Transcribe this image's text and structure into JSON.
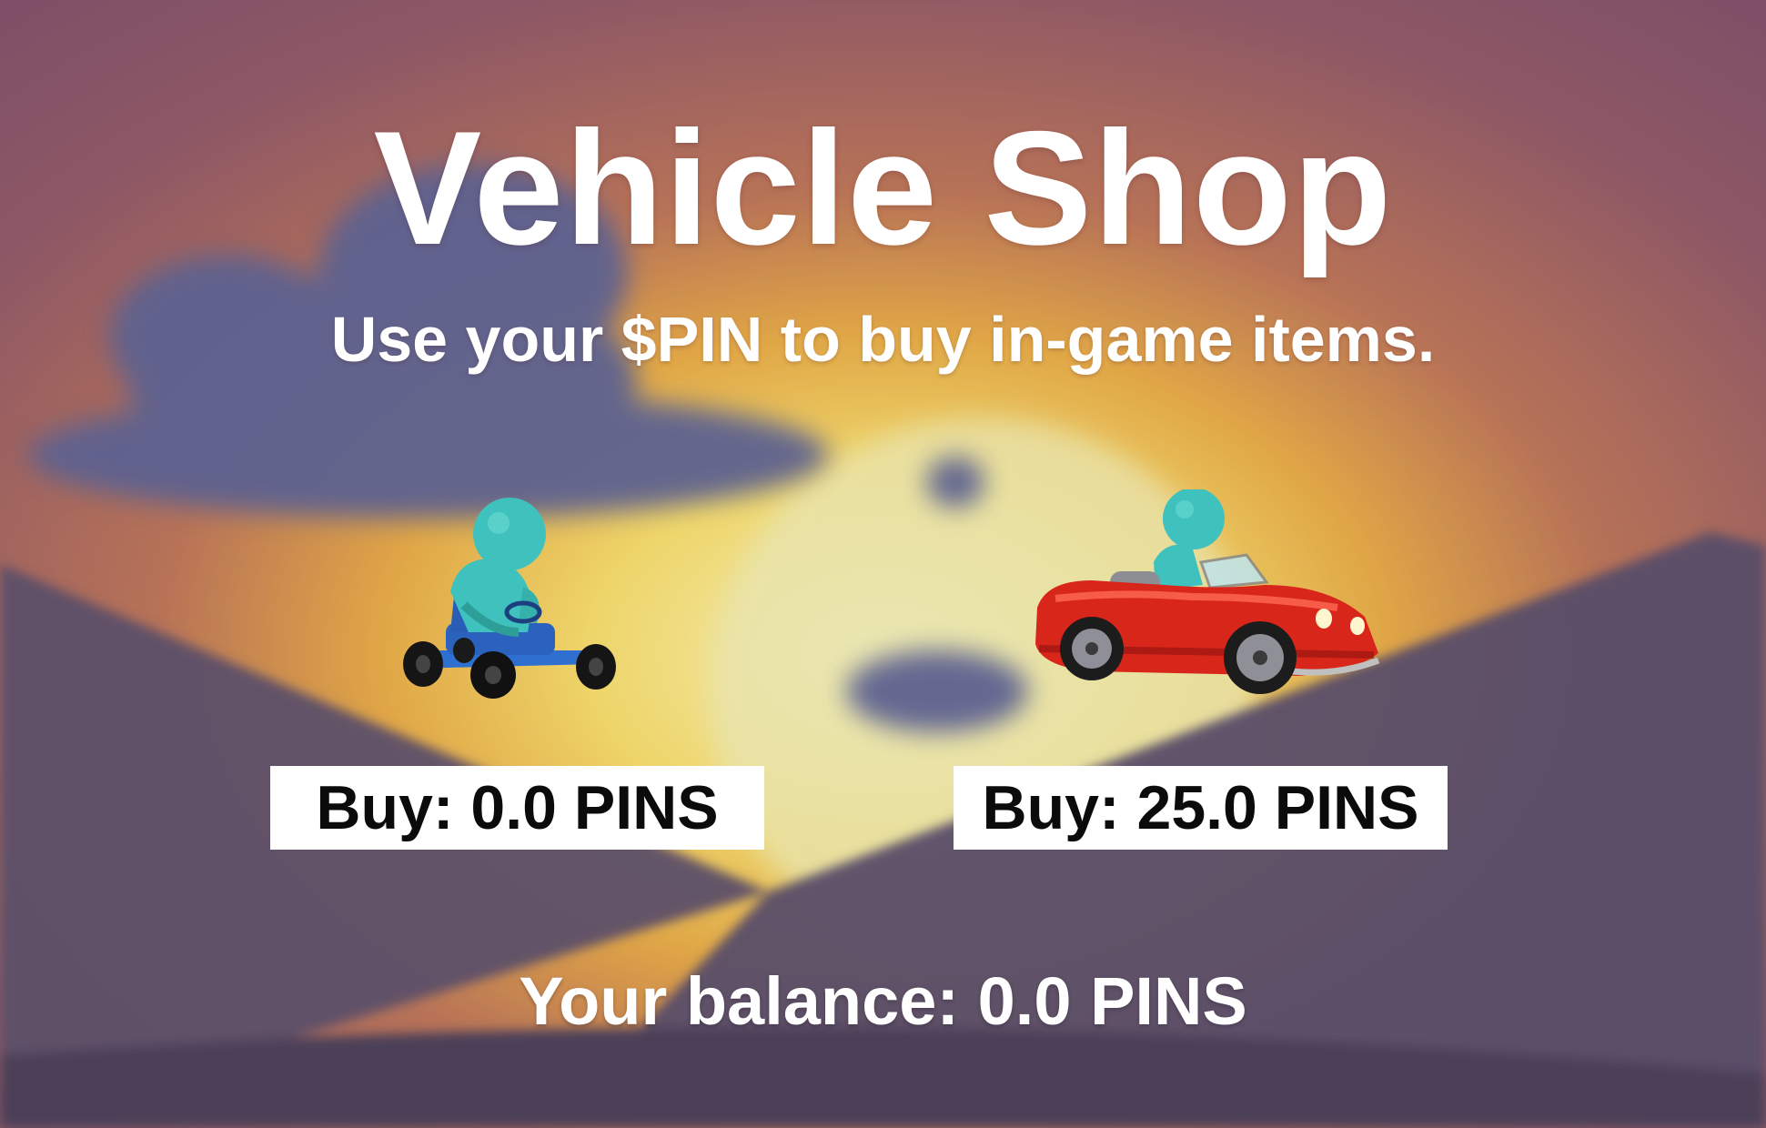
{
  "shop": {
    "title": "Vehicle Shop",
    "subtitle": "Use your $PIN to buy in-game items."
  },
  "items": [
    {
      "name": "kart",
      "icon": "go-kart-vehicle-icon",
      "buy_label": "Buy: 0.0 PINS"
    },
    {
      "name": "car",
      "icon": "red-convertible-car-icon",
      "buy_label": "Buy: 25.0 PINS"
    }
  ],
  "balance": {
    "label": "Your balance: 0.0 PINS"
  },
  "colors": {
    "text": "#ffffff",
    "button_bg": "#ffffff",
    "button_text": "#0b0b0b",
    "kart": "#2f6fd0",
    "car": "#d8261b",
    "driver": "#3fc2bd"
  }
}
